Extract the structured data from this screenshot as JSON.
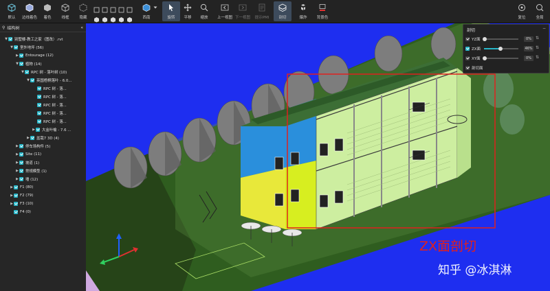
{
  "toolbar": {
    "items": [
      {
        "label": "默认"
      },
      {
        "label": "边线着色"
      },
      {
        "label": "着色"
      },
      {
        "label": "线框"
      },
      {
        "label": "隐藏"
      },
      {
        "label": "西南"
      },
      {
        "label": "旋转"
      },
      {
        "label": "平移"
      },
      {
        "label": "缩放"
      },
      {
        "label": "上一视图"
      },
      {
        "label": "下一视图"
      },
      {
        "label": "提示PMI"
      },
      {
        "label": "剖切"
      },
      {
        "label": "爆炸"
      },
      {
        "label": "背景色"
      },
      {
        "label": "复位"
      },
      {
        "label": "全局"
      }
    ]
  },
  "sidebar": {
    "title": "结构树",
    "tree": [
      {
        "label": "别墅楼-教工之家（图改）.rvt"
      },
      {
        "label": "室外地坪 (56)"
      },
      {
        "label": "Entourage (12)"
      },
      {
        "label": "植物 (14)"
      },
      {
        "label": "RPC 树 - 落叶树 (10)"
      },
      {
        "label": "英国梧桐落叶 - 6.0..."
      },
      {
        "label": "RPC 树 - 落..."
      },
      {
        "label": "RPC 树 - 落..."
      },
      {
        "label": "RPC 树 - 落..."
      },
      {
        "label": "RPC 树 - 落..."
      },
      {
        "label": "RPC 树 - 落..."
      },
      {
        "label": "大金叶榆 - 7.6 ..."
      },
      {
        "label": "盆栽7 3D (4)"
      },
      {
        "label": "停车场构件 (5)"
      },
      {
        "label": "Site (11)"
      },
      {
        "label": "坡道 (1)"
      },
      {
        "label": "常规模型 (1)"
      },
      {
        "label": "墙 (12)"
      },
      {
        "label": "F1 (80)"
      },
      {
        "label": "F2 (79)"
      },
      {
        "label": "F3 (10)"
      },
      {
        "label": "F4 (0)"
      }
    ]
  },
  "section_panel": {
    "title": "剖切",
    "rows": [
      {
        "label": "YZ面",
        "value": "0%"
      },
      {
        "label": "ZX面",
        "value": "46%"
      },
      {
        "label": "XY面",
        "value": "0%"
      }
    ],
    "footer": "剖切面"
  },
  "annotation": "ZX面剖切",
  "watermark": "知乎 @冰淇淋"
}
